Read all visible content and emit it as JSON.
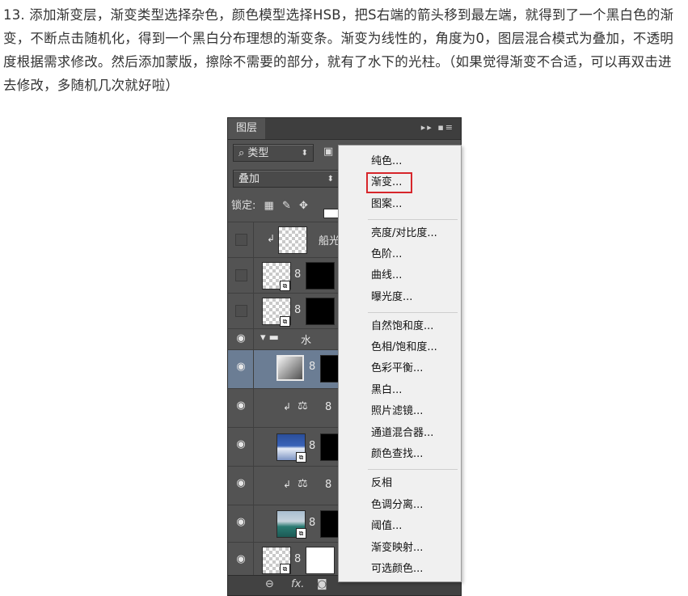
{
  "instruction": "13. 添加渐变层，渐变类型选择杂色，颜色模型选择HSB，把S右端的箭头移到最左端，就得到了一个黑白色的渐变，不断点击随机化，得到一个黑白分布理想的渐变条。渐变为线性的，角度为0，图层混合模式为叠加，不透明度根据需求修改。然后添加蒙版，擦除不需要的部分，就有了水下的光柱。（如果觉得渐变不合适，可以再双击进去修改，多随机几次就好啦）",
  "panel": {
    "tab": "图层",
    "kind_filter": "类型",
    "blend_mode": "叠加",
    "lock_label": "锁定:",
    "layers": [
      {
        "name": "船光"
      },
      {
        "name": ""
      },
      {
        "name": ""
      },
      {
        "name": "水"
      }
    ]
  },
  "menu": {
    "items": [
      "纯色...",
      "渐变...",
      "图案...",
      "亮度/对比度...",
      "色阶...",
      "曲线...",
      "曝光度...",
      "自然饱和度...",
      "色相/饱和度...",
      "色彩平衡...",
      "黑白...",
      "照片滤镜...",
      "通道混合器...",
      "颜色查找...",
      "反相",
      "色调分离...",
      "阈值...",
      "渐变映射...",
      "可选颜色..."
    ],
    "highlighted": "渐变..."
  },
  "colors": {
    "highlight_box": "#d7262b",
    "selected_layer": "#6b7d94",
    "panel_bg": "#535353"
  }
}
